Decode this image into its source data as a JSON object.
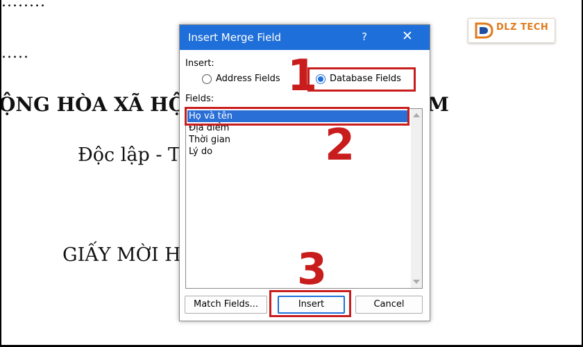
{
  "document": {
    "dots_top": "........",
    "dots_second": ".....",
    "heading_left": "ỘNG HÒA XÃ HỘI",
    "heading_right": "M",
    "motto": "Độc lập - T",
    "invitation": "GIẤY MỜI H"
  },
  "logo": {
    "text": "DLZ TECH",
    "brand_color": "#e07a1c"
  },
  "dialog": {
    "title": "Insert Merge Field",
    "help_glyph": "?",
    "close_glyph": "✕",
    "insert_label": "Insert:",
    "radio_address": "Address Fields",
    "radio_database": "Database Fields",
    "selected_radio": "Database Fields",
    "fields_label": "Fields:",
    "fields": [
      "Họ và tên",
      "Địa điểm",
      "Thời gian",
      "Lý do"
    ],
    "selected_field": "Họ và tên",
    "buttons": {
      "match_fields": "Match Fields...",
      "insert": "Insert",
      "cancel": "Cancel"
    },
    "accent_color": "#1e6fd9"
  },
  "annotations": {
    "step1": "1",
    "step2": "2",
    "step3": "3",
    "color": "#c91c1c"
  }
}
